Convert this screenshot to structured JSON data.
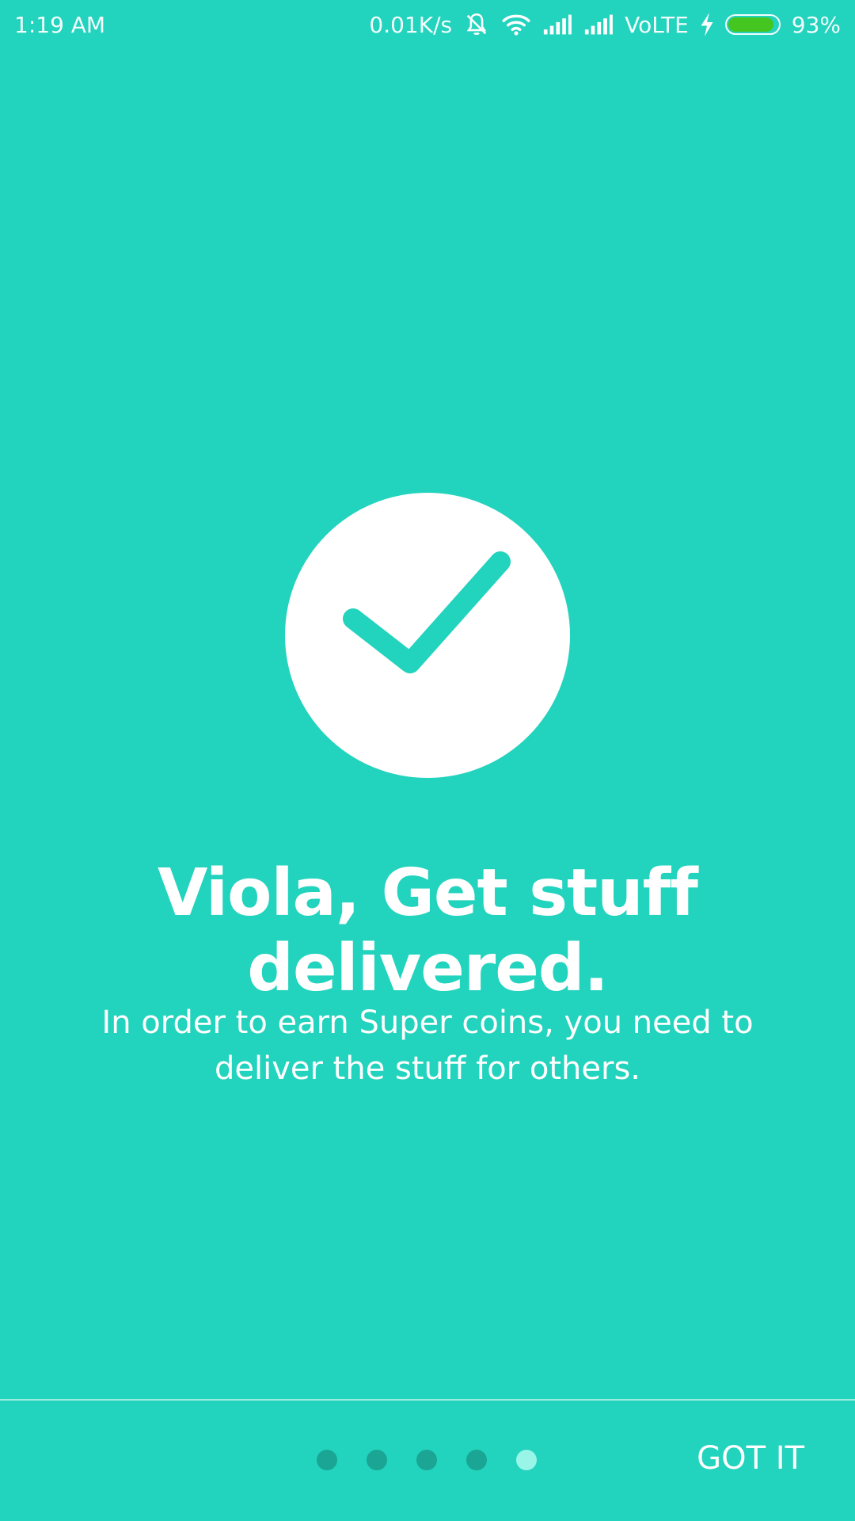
{
  "status_bar": {
    "time": "1:19 AM",
    "net_speed": "0.01K/s",
    "carrier_tech": "VoLTE",
    "battery": "93%",
    "battery_level": 0.93,
    "battery_color": "#45c51f",
    "icons": [
      "mute-bell-icon",
      "wifi-icon",
      "signal-icon",
      "signal-icon",
      "charging-icon",
      "battery-icon"
    ]
  },
  "onboarding": {
    "icon": "check-icon",
    "title": "Viola, Get stuff delivered.",
    "subtitle": "In order to earn Super coins, you need to deliver the stuff for others.",
    "accent_color": "#22d3bd"
  },
  "pager": {
    "total": 5,
    "active_index": 4,
    "dot_color": "#1aa594",
    "active_dot_color": "#98f5e8"
  },
  "actions": {
    "got_it_label": "GOT IT"
  }
}
